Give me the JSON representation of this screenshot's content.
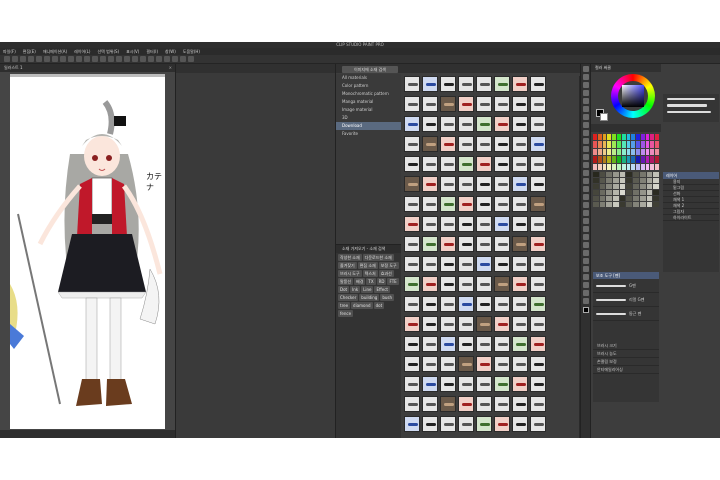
{
  "window": {
    "title": "CLIP STUDIO PAINT PRO"
  },
  "menu": [
    "파일(F)",
    "편집(E)",
    "애니메이션(A)",
    "레이어(L)",
    "선택 범위(S)",
    "표시(V)",
    "필터(I)",
    "창(W)",
    "도움말(H)"
  ],
  "canvas": {
    "tab": "일러스트 1",
    "signature": "カテナ"
  },
  "material": {
    "tab": "이미지에 소재 검색",
    "tree": [
      {
        "label": "All materials",
        "selected": false
      },
      {
        "label": "Color pattern",
        "selected": false
      },
      {
        "label": "Monochromatic pattern",
        "selected": false
      },
      {
        "label": "Manga material",
        "selected": false
      },
      {
        "label": "Image material",
        "selected": false
      },
      {
        "label": "3D",
        "selected": false
      },
      {
        "label": "Download",
        "selected": true
      },
      {
        "label": "Favorite",
        "selected": false
      }
    ],
    "tag_header": "소재 가져오기 - 소재 검색",
    "tags": [
      "작성한 소재",
      "다운로드한 소재",
      "즐겨찾기",
      "편집 소재",
      "보정 도구",
      "브러시 도구",
      "텍스처",
      "효과선",
      "말풍선",
      "배경",
      "TX",
      "RD",
      "FTE",
      "Dot",
      "Ink",
      "Line",
      "Effect",
      "Checker",
      "building",
      "bush",
      "tree",
      "diamond",
      "dot",
      "fence"
    ]
  },
  "color": {
    "header": "컬러 써클"
  },
  "layers": {
    "header": "레이어",
    "rows": [
      "용지",
      "밑그림",
      "선화",
      "채색 1",
      "채색 2",
      "그림자",
      "하이라이트"
    ]
  },
  "subtool": {
    "header": "보조 도구 [펜]",
    "items": [
      "G펜",
      "리얼 G펜",
      "둥근 펜"
    ]
  },
  "tool_property": {
    "rows": [
      "브러시 크기",
      "브러시 농도",
      "손떨림 보정",
      "안티에일리어싱"
    ]
  },
  "colors": {
    "panel_bg": "#3d3d3d",
    "accent": "#4a5a78"
  }
}
